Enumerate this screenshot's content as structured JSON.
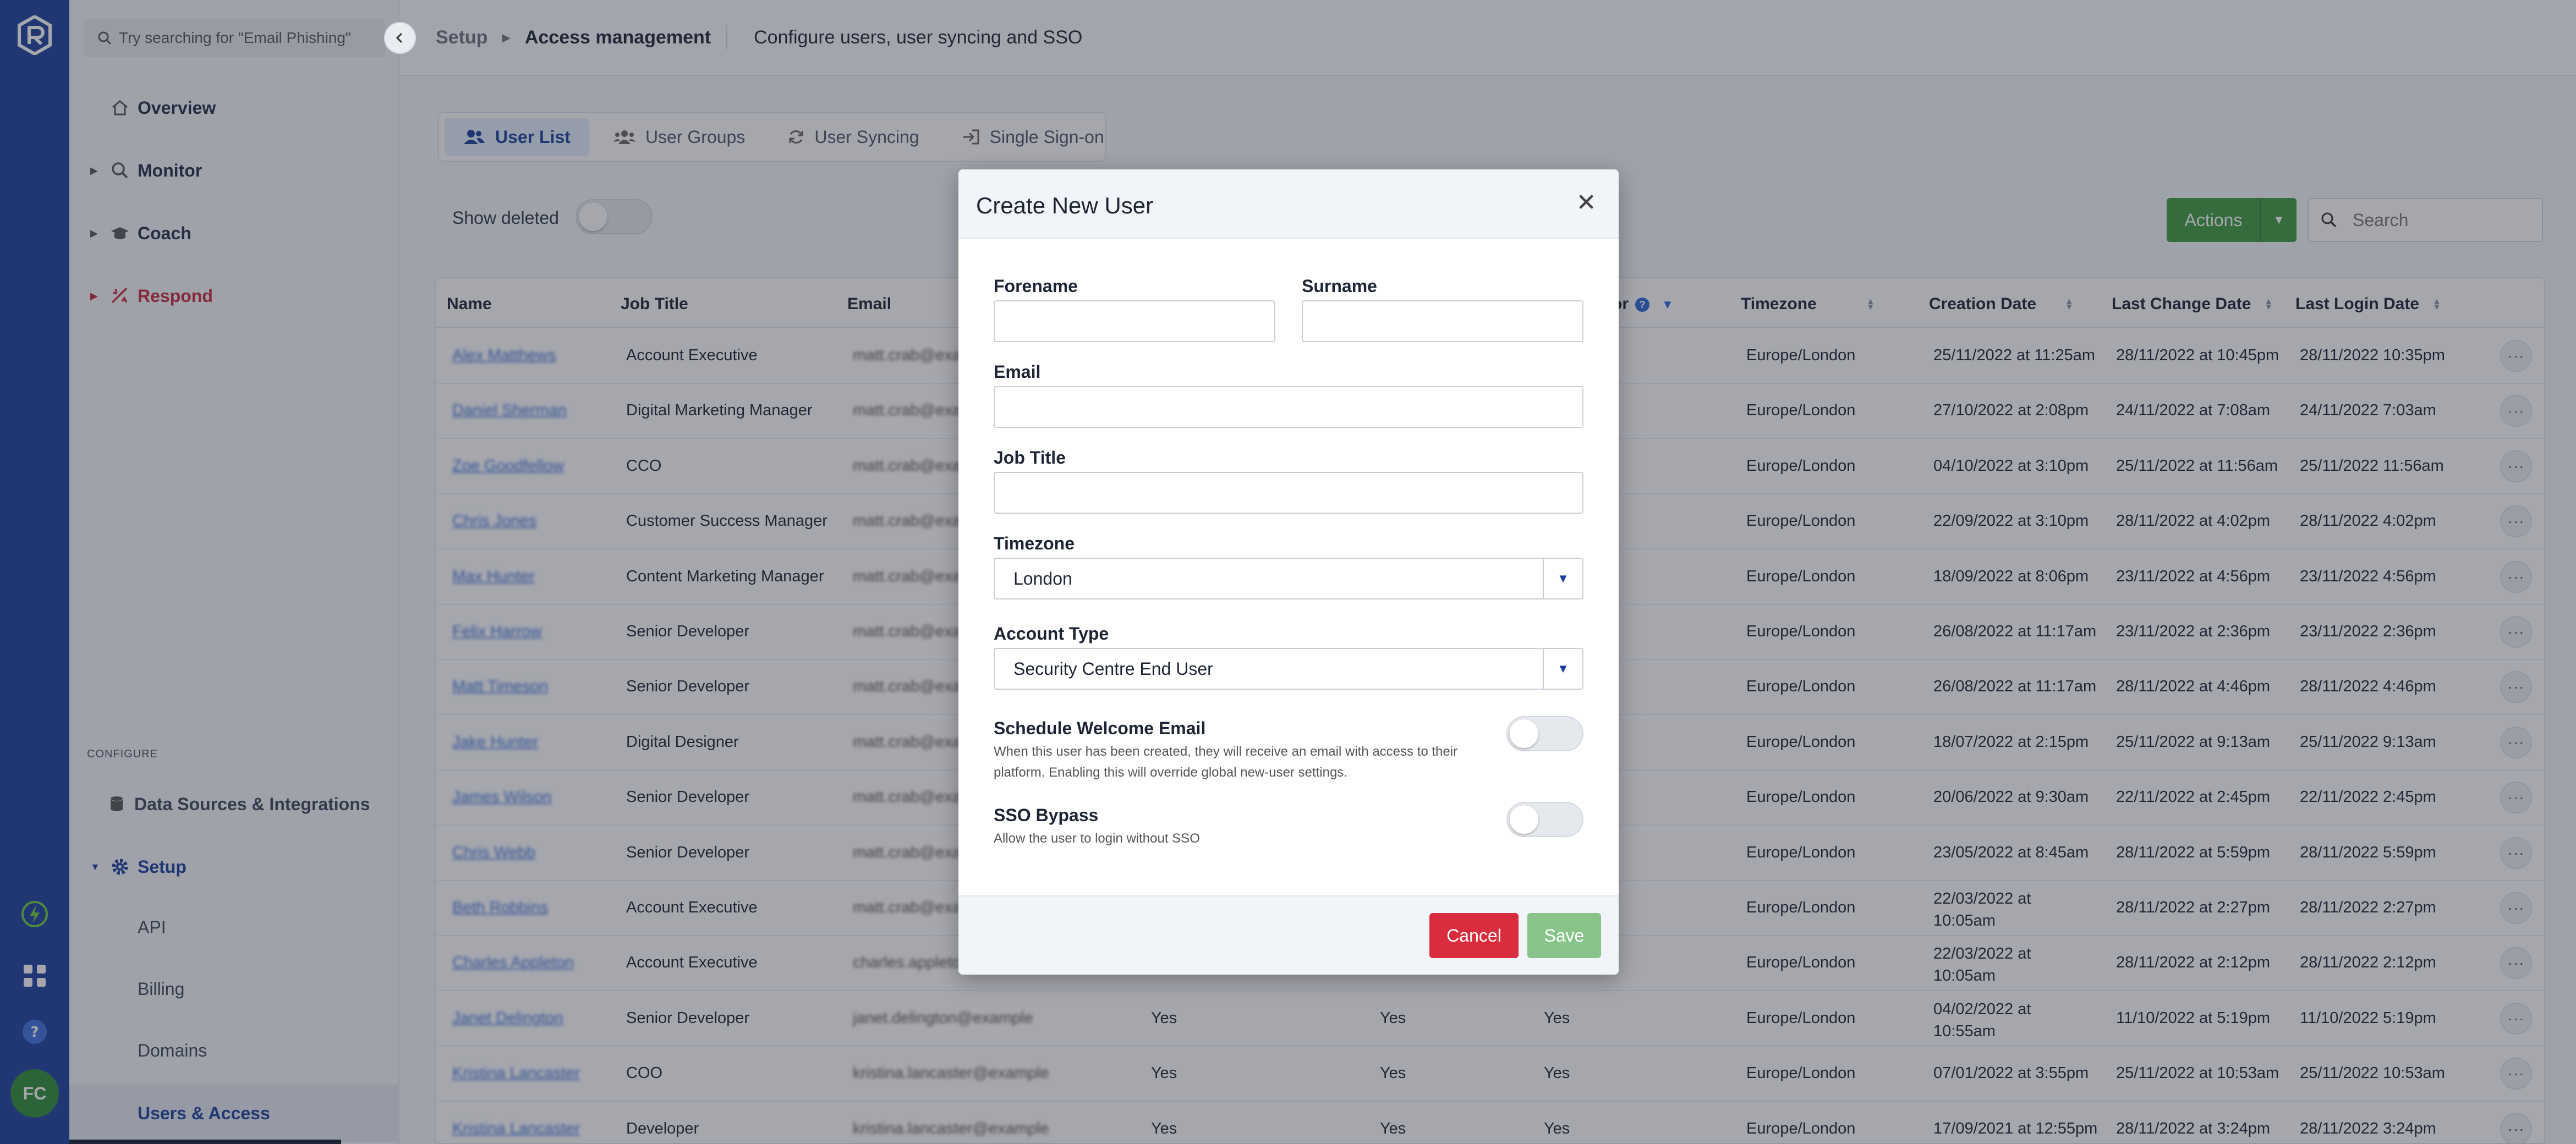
{
  "search": {
    "placeholder": "Try searching for \"Email Phishing\""
  },
  "user": {
    "initials": "FC"
  },
  "nav": {
    "overview": "Overview",
    "monitor": "Monitor",
    "coach": "Coach",
    "respond": "Respond",
    "configure_heading": "CONFIGURE",
    "data_sources": "Data Sources & Integrations",
    "setup": "Setup",
    "setup_items": [
      "API",
      "Billing",
      "Domains",
      "Users & Access"
    ]
  },
  "breadcrumb": {
    "root": "Setup",
    "current": "Access management",
    "description": "Configure users, user syncing and SSO"
  },
  "tabs": [
    "User List",
    "User Groups",
    "User Syncing",
    "Single Sign-on"
  ],
  "toolbar": {
    "show_deleted": "Show deleted",
    "actions": "Actions",
    "search_placeholder": "Search"
  },
  "table": {
    "columns": {
      "name": "Name",
      "job_title": "Job Title",
      "email": "Email",
      "partial": "or",
      "timezone": "Timezone",
      "creation": "Creation Date",
      "last_change": "Last Change Date",
      "last_login": "Last Login Date"
    },
    "rows": [
      {
        "name": "Alex Matthews",
        "job": "Account Executive",
        "email": "matt.crab@example",
        "yes1": "",
        "yes2": "",
        "yes3": "",
        "tz": "Europe/London",
        "created": "25/11/2022 at 11:25am",
        "changed": "28/11/2022 at 10:45pm",
        "login": "28/11/2022 10:35pm"
      },
      {
        "name": "Daniel Sherman",
        "job": "Digital Marketing Manager",
        "email": "matt.crab@example",
        "yes1": "",
        "yes2": "",
        "yes3": "",
        "tz": "Europe/London",
        "created": "27/10/2022 at 2:08pm",
        "changed": "24/11/2022 at 7:08am",
        "login": "24/11/2022 7:03am"
      },
      {
        "name": "Zoe Goodfellow",
        "job": "CCO",
        "email": "matt.crab@example",
        "yes1": "",
        "yes2": "",
        "yes3": "",
        "tz": "Europe/London",
        "created": "04/10/2022 at 3:10pm",
        "changed": "25/11/2022 at 11:56am",
        "login": "25/11/2022 11:56am"
      },
      {
        "name": "Chris Jones",
        "job": "Customer Success Manager",
        "email": "matt.crab@example",
        "yes1": "",
        "yes2": "",
        "yes3": "",
        "tz": "Europe/London",
        "created": "22/09/2022 at 3:10pm",
        "changed": "28/11/2022 at 4:02pm",
        "login": "28/11/2022 4:02pm"
      },
      {
        "name": "Max Hunter",
        "job": "Content Marketing Manager",
        "email": "matt.crab@example",
        "yes1": "",
        "yes2": "",
        "yes3": "",
        "tz": "Europe/London",
        "created": "18/09/2022 at 8:06pm",
        "changed": "23/11/2022 at 4:56pm",
        "login": "23/11/2022 4:56pm"
      },
      {
        "name": "Felix Harrow",
        "job": "Senior Developer",
        "email": "matt.crab@example",
        "yes1": "",
        "yes2": "",
        "yes3": "",
        "tz": "Europe/London",
        "created": "26/08/2022 at 11:17am",
        "changed": "23/11/2022 at 2:36pm",
        "login": "23/11/2022 2:36pm"
      },
      {
        "name": "Matt Timeson",
        "job": "Senior Developer",
        "email": "matt.crab@example",
        "yes1": "",
        "yes2": "",
        "yes3": "",
        "tz": "Europe/London",
        "created": "26/08/2022 at 11:17am",
        "changed": "28/11/2022 at 4:46pm",
        "login": "28/11/2022 4:46pm"
      },
      {
        "name": "Jake Hunter",
        "job": "Digital Designer",
        "email": "matt.crab@example",
        "yes1": "",
        "yes2": "",
        "yes3": "",
        "tz": "Europe/London",
        "created": "18/07/2022 at 2:15pm",
        "changed": "25/11/2022 at 9:13am",
        "login": "25/11/2022 9:13am"
      },
      {
        "name": "James Wilson",
        "job": "Senior Developer",
        "email": "matt.crab@example",
        "yes1": "",
        "yes2": "",
        "yes3": "",
        "tz": "Europe/London",
        "created": "20/06/2022 at 9:30am",
        "changed": "22/11/2022 at 2:45pm",
        "login": "22/11/2022 2:45pm"
      },
      {
        "name": "Chris Webb",
        "job": "Senior Developer",
        "email": "matt.crab@example",
        "yes1": "",
        "yes2": "",
        "yes3": "",
        "tz": "Europe/London",
        "created": "23/05/2022 at 8:45am",
        "changed": "28/11/2022 at 5:59pm",
        "login": "28/11/2022 5:59pm"
      },
      {
        "name": "Beth Robbins",
        "job": "Account Executive",
        "email": "matt.crab@example",
        "yes1": "",
        "yes2": "",
        "yes3": "",
        "tz": "Europe/London",
        "created": "22/03/2022 at 10:05am",
        "changed": "28/11/2022 at 2:27pm",
        "login": "28/11/2022 2:27pm"
      },
      {
        "name": "Charles Appleton",
        "job": "Account Executive",
        "email": "charles.appleton@example",
        "yes1": "",
        "yes2": "",
        "yes3": "",
        "tz": "Europe/London",
        "created": "22/03/2022 at 10:05am",
        "changed": "28/11/2022 at 2:12pm",
        "login": "28/11/2022 2:12pm"
      },
      {
        "name": "Janet Delington",
        "job": "Senior Developer",
        "email": "janet.delington@example",
        "yes1": "Yes",
        "yes2": "Yes",
        "yes3": "Yes",
        "tz": "Europe/London",
        "created": "04/02/2022 at 10:55am",
        "changed": "11/10/2022 at 5:19pm",
        "login": "11/10/2022 5:19pm"
      },
      {
        "name": "Kristina Lancaster",
        "job": "COO",
        "email": "kristina.lancaster@example",
        "yes1": "Yes",
        "yes2": "Yes",
        "yes3": "Yes",
        "tz": "Europe/London",
        "created": "07/01/2022 at 3:55pm",
        "changed": "25/11/2022 at 10:53am",
        "login": "25/11/2022 10:53am"
      },
      {
        "name": "Kristina Lancaster",
        "job": "Developer",
        "email": "kristina.lancaster@example",
        "yes1": "Yes",
        "yes2": "Yes",
        "yes3": "Yes",
        "tz": "Europe/London",
        "created": "17/09/2021 at 12:55pm",
        "changed": "28/11/2022 at 3:24pm",
        "login": "28/11/2022 3:24pm"
      }
    ]
  },
  "modal": {
    "title": "Create New User",
    "forename_label": "Forename",
    "surname_label": "Surname",
    "email_label": "Email",
    "job_title_label": "Job Title",
    "timezone_label": "Timezone",
    "timezone_value": "London",
    "account_type_label": "Account Type",
    "account_type_value": "Security Centre End User",
    "welcome_label": "Schedule Welcome Email",
    "welcome_help": "When this user has been created, they will receive an email with access to their platform. Enabling this will override global new-user settings.",
    "sso_label": "SSO Bypass",
    "sso_help": "Allow the user to login without SSO",
    "cancel": "Cancel",
    "save": "Save"
  },
  "colors": {
    "brand": "#1b3f9e",
    "action_green": "#3e9a3e",
    "danger": "#d92c3c",
    "respond": "#c8283a"
  }
}
